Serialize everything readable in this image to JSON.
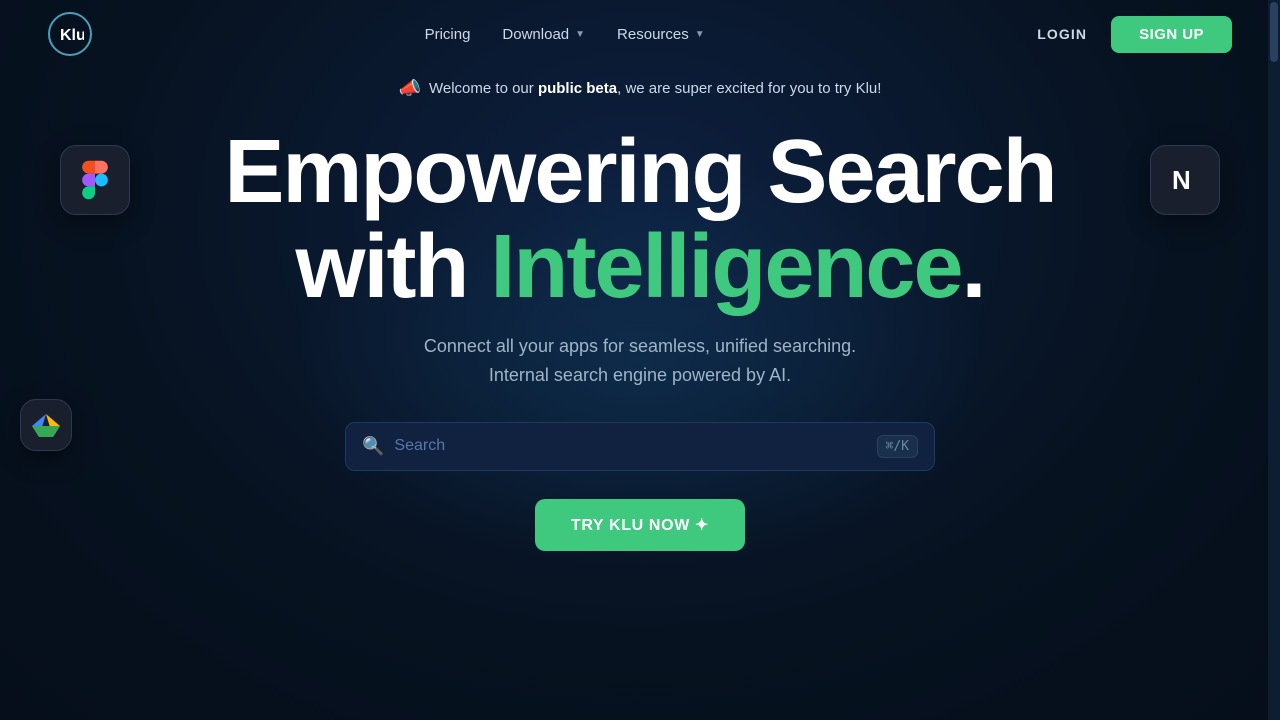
{
  "navbar": {
    "logo_text": "Klu",
    "nav_items": [
      {
        "label": "Pricing",
        "has_dropdown": false
      },
      {
        "label": "Download",
        "has_dropdown": true
      },
      {
        "label": "Resources",
        "has_dropdown": true
      }
    ],
    "login_label": "LOGIN",
    "signup_label": "SIGN UP"
  },
  "banner": {
    "icon": "📣",
    "text_before_bold": "Welcome to our ",
    "bold_text": "public beta",
    "text_after_bold": ", we are super excited for you to try Klu!"
  },
  "hero": {
    "title_line1": "Empowering Search",
    "title_line2_prefix": "with ",
    "title_line2_highlight": "Intelligence",
    "title_line2_suffix": ".",
    "subtitle_line1": "Connect all your apps for seamless, unified searching.",
    "subtitle_line2": "Internal search engine powered by AI."
  },
  "search": {
    "placeholder": "Search",
    "shortcut": "⌘/K"
  },
  "cta": {
    "label": "TRY KLU NOW ✦"
  },
  "colors": {
    "green_accent": "#3ec97e",
    "bg_dark": "#0a1628",
    "nav_bg": "#091525"
  }
}
